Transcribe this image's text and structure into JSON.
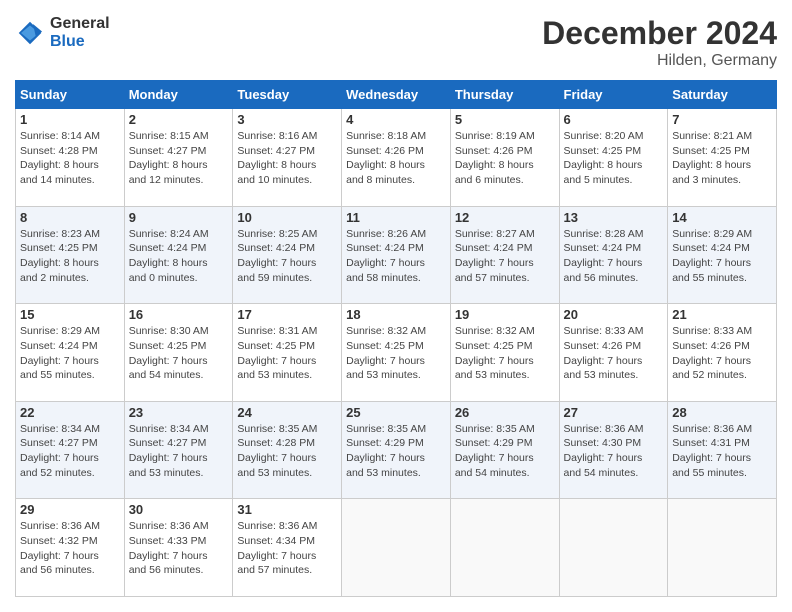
{
  "logo": {
    "general": "General",
    "blue": "Blue"
  },
  "header": {
    "title": "December 2024",
    "subtitle": "Hilden, Germany"
  },
  "calendar": {
    "days_of_week": [
      "Sunday",
      "Monday",
      "Tuesday",
      "Wednesday",
      "Thursday",
      "Friday",
      "Saturday"
    ],
    "weeks": [
      [
        {
          "day": "1",
          "sunrise": "8:14 AM",
          "sunset": "4:28 PM",
          "daylight": "8 hours and 14 minutes."
        },
        {
          "day": "2",
          "sunrise": "8:15 AM",
          "sunset": "4:27 PM",
          "daylight": "8 hours and 12 minutes."
        },
        {
          "day": "3",
          "sunrise": "8:16 AM",
          "sunset": "4:27 PM",
          "daylight": "8 hours and 10 minutes."
        },
        {
          "day": "4",
          "sunrise": "8:18 AM",
          "sunset": "4:26 PM",
          "daylight": "8 hours and 8 minutes."
        },
        {
          "day": "5",
          "sunrise": "8:19 AM",
          "sunset": "4:26 PM",
          "daylight": "8 hours and 6 minutes."
        },
        {
          "day": "6",
          "sunrise": "8:20 AM",
          "sunset": "4:25 PM",
          "daylight": "8 hours and 5 minutes."
        },
        {
          "day": "7",
          "sunrise": "8:21 AM",
          "sunset": "4:25 PM",
          "daylight": "8 hours and 3 minutes."
        }
      ],
      [
        {
          "day": "8",
          "sunrise": "8:23 AM",
          "sunset": "4:25 PM",
          "daylight": "8 hours and 2 minutes."
        },
        {
          "day": "9",
          "sunrise": "8:24 AM",
          "sunset": "4:24 PM",
          "daylight": "8 hours and 0 minutes."
        },
        {
          "day": "10",
          "sunrise": "8:25 AM",
          "sunset": "4:24 PM",
          "daylight": "7 hours and 59 minutes."
        },
        {
          "day": "11",
          "sunrise": "8:26 AM",
          "sunset": "4:24 PM",
          "daylight": "7 hours and 58 minutes."
        },
        {
          "day": "12",
          "sunrise": "8:27 AM",
          "sunset": "4:24 PM",
          "daylight": "7 hours and 57 minutes."
        },
        {
          "day": "13",
          "sunrise": "8:28 AM",
          "sunset": "4:24 PM",
          "daylight": "7 hours and 56 minutes."
        },
        {
          "day": "14",
          "sunrise": "8:29 AM",
          "sunset": "4:24 PM",
          "daylight": "7 hours and 55 minutes."
        }
      ],
      [
        {
          "day": "15",
          "sunrise": "8:29 AM",
          "sunset": "4:24 PM",
          "daylight": "7 hours and 55 minutes."
        },
        {
          "day": "16",
          "sunrise": "8:30 AM",
          "sunset": "4:25 PM",
          "daylight": "7 hours and 54 minutes."
        },
        {
          "day": "17",
          "sunrise": "8:31 AM",
          "sunset": "4:25 PM",
          "daylight": "7 hours and 53 minutes."
        },
        {
          "day": "18",
          "sunrise": "8:32 AM",
          "sunset": "4:25 PM",
          "daylight": "7 hours and 53 minutes."
        },
        {
          "day": "19",
          "sunrise": "8:32 AM",
          "sunset": "4:25 PM",
          "daylight": "7 hours and 53 minutes."
        },
        {
          "day": "20",
          "sunrise": "8:33 AM",
          "sunset": "4:26 PM",
          "daylight": "7 hours and 53 minutes."
        },
        {
          "day": "21",
          "sunrise": "8:33 AM",
          "sunset": "4:26 PM",
          "daylight": "7 hours and 52 minutes."
        }
      ],
      [
        {
          "day": "22",
          "sunrise": "8:34 AM",
          "sunset": "4:27 PM",
          "daylight": "7 hours and 52 minutes."
        },
        {
          "day": "23",
          "sunrise": "8:34 AM",
          "sunset": "4:27 PM",
          "daylight": "7 hours and 53 minutes."
        },
        {
          "day": "24",
          "sunrise": "8:35 AM",
          "sunset": "4:28 PM",
          "daylight": "7 hours and 53 minutes."
        },
        {
          "day": "25",
          "sunrise": "8:35 AM",
          "sunset": "4:29 PM",
          "daylight": "7 hours and 53 minutes."
        },
        {
          "day": "26",
          "sunrise": "8:35 AM",
          "sunset": "4:29 PM",
          "daylight": "7 hours and 54 minutes."
        },
        {
          "day": "27",
          "sunrise": "8:36 AM",
          "sunset": "4:30 PM",
          "daylight": "7 hours and 54 minutes."
        },
        {
          "day": "28",
          "sunrise": "8:36 AM",
          "sunset": "4:31 PM",
          "daylight": "7 hours and 55 minutes."
        }
      ],
      [
        {
          "day": "29",
          "sunrise": "8:36 AM",
          "sunset": "4:32 PM",
          "daylight": "7 hours and 56 minutes."
        },
        {
          "day": "30",
          "sunrise": "8:36 AM",
          "sunset": "4:33 PM",
          "daylight": "7 hours and 56 minutes."
        },
        {
          "day": "31",
          "sunrise": "8:36 AM",
          "sunset": "4:34 PM",
          "daylight": "7 hours and 57 minutes."
        },
        null,
        null,
        null,
        null
      ]
    ]
  }
}
